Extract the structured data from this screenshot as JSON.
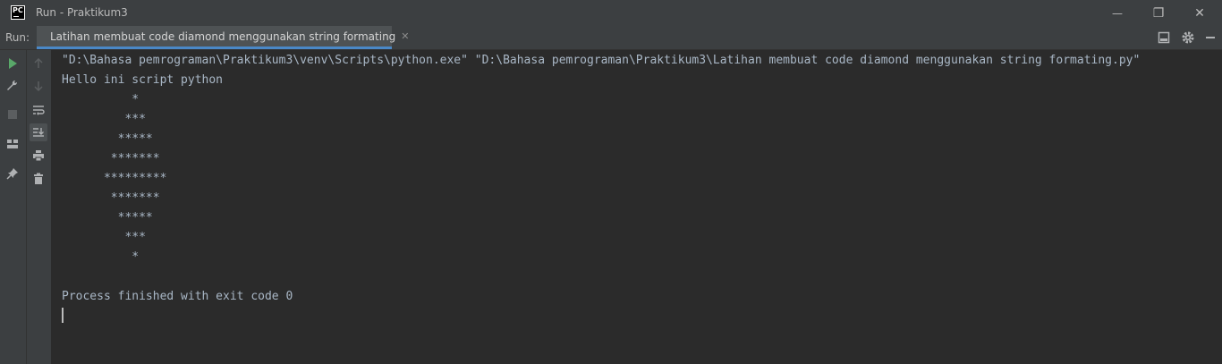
{
  "window": {
    "title": "Run - Praktikum3",
    "logo_text": "PC",
    "minimize_glyph": "—",
    "restore_glyph": "❐",
    "close_glyph": "✕"
  },
  "run_panel": {
    "label": "Run:",
    "tab": {
      "label": "Latihan membuat code diamond menggunakan string formating",
      "close_glyph": "✕"
    }
  },
  "console": {
    "command": "\"D:\\Bahasa pemrograman\\Praktikum3\\venv\\Scripts\\python.exe\" \"D:\\Bahasa pemrograman\\Praktikum3\\Latihan membuat code diamond menggunakan string formating.py\"",
    "output_lines": [
      "Hello ini script python",
      "          *",
      "         ***",
      "        *****",
      "       *******",
      "      *********",
      "       *******",
      "        *****",
      "         ***",
      "          *",
      "",
      "Process finished with exit code 0"
    ]
  },
  "colors": {
    "background": "#2b2b2b",
    "panel": "#3c3f41",
    "text": "#a9b7c6",
    "accent": "#4a88c7",
    "run_green": "#59a869"
  },
  "icons": {
    "rerun": "play-icon",
    "settings_tool": "wrench-icon",
    "stop": "stop-icon",
    "layout": "layout-icon",
    "pin": "pin-icon",
    "up": "arrow-up-icon",
    "down": "arrow-down-icon",
    "soft_wrap": "soft-wrap-icon",
    "scroll_to_end": "scroll-to-end-icon",
    "print": "print-icon",
    "clear": "trash-icon",
    "hide_panel": "hide-panel-icon",
    "gear": "gear-icon",
    "minimize_panel": "minimize-panel-icon"
  }
}
